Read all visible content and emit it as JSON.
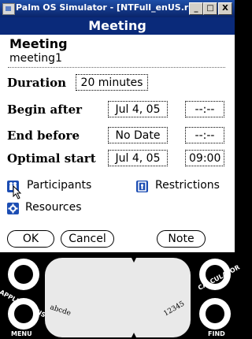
{
  "window": {
    "title": "Palm OS Simulator - [NTFull_enUS.rom]",
    "btn_min": "_",
    "btn_max": "□",
    "btn_close": "X"
  },
  "form": {
    "title": "Meeting",
    "meeting_label": "Meeting",
    "meeting_value": "meeting1",
    "duration_label": "Duration",
    "duration_value": "20 minutes",
    "begin_label": "Begin after",
    "begin_date": "Jul 4, 05",
    "begin_time": "--:--",
    "end_label": "End before",
    "end_date": "No Date",
    "end_time": "--:--",
    "optimal_label": "Optimal start",
    "optimal_date": "Jul 4, 05",
    "optimal_time": "09:00",
    "participants_label": "Participants",
    "restrictions_label": "Restrictions",
    "resources_label": "Resources",
    "ok_label": "OK",
    "cancel_label": "Cancel",
    "note_label": "Note"
  },
  "silkscreen": {
    "applications": "APPLICATIONS",
    "menu": "MENU",
    "calculator": "CALCULATOR",
    "find": "FIND",
    "graffiti_alpha": "abcde",
    "graffiti_num": "12345"
  }
}
